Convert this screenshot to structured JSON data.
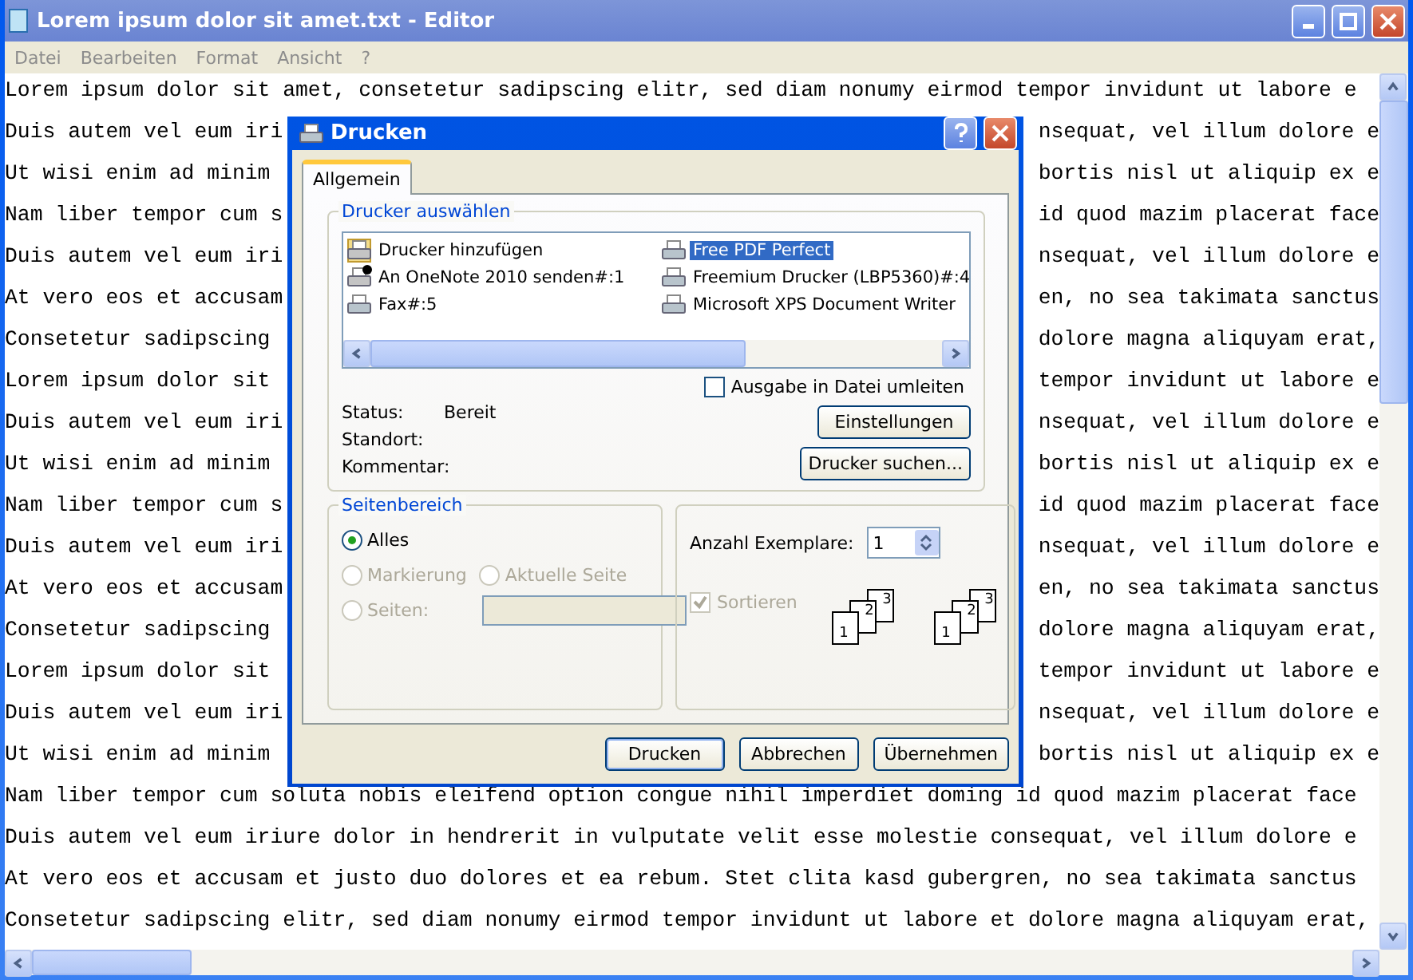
{
  "window": {
    "title": "Lorem ipsum dolor sit amet.txt - Editor"
  },
  "menu": [
    "Datei",
    "Bearbeiten",
    "Format",
    "Ansicht",
    "?"
  ],
  "editor": {
    "lines": [
      {
        "left": "Lorem ipsum dolor sit amet, consetetur sadipscing elitr, sed diam nonumy eirmod tempor invidunt ut labore e"
      },
      {
        "left": "Duis autem vel eum iri",
        "right": "nsequat, vel illum dolore e"
      },
      {
        "left": "Ut wisi enim ad minim",
        "right": "bortis nisl ut aliquip ex e"
      },
      {
        "left": "Nam liber tempor cum s",
        "right": "id quod mazim placerat face"
      },
      {
        "left": "Duis autem vel eum iri",
        "right": "nsequat, vel illum dolore e"
      },
      {
        "left": "At vero eos et accusam",
        "right": "en, no sea takimata sanctus"
      },
      {
        "left": "Consetetur sadipscing",
        "right": "dolore magna aliquyam erat,"
      },
      {
        "left": "Lorem ipsum dolor sit",
        "right": "tempor invidunt ut labore e"
      },
      {
        "left": "Duis autem vel eum iri",
        "right": "nsequat, vel illum dolore e"
      },
      {
        "left": "Ut wisi enim ad minim",
        "right": "bortis nisl ut aliquip ex e"
      },
      {
        "left": "Nam liber tempor cum s",
        "right": "id quod mazim placerat face"
      },
      {
        "left": "Duis autem vel eum iri",
        "right": "nsequat, vel illum dolore e"
      },
      {
        "left": "At vero eos et accusam",
        "right": "en, no sea takimata sanctus"
      },
      {
        "left": "Consetetur sadipscing",
        "right": "dolore magna aliquyam erat,"
      },
      {
        "left": "Lorem ipsum dolor sit",
        "right": "tempor invidunt ut labore e"
      },
      {
        "left": "Duis autem vel eum iri",
        "right": "nsequat, vel illum dolore e"
      },
      {
        "left": "Ut wisi enim ad minim",
        "right": "bortis nisl ut aliquip ex e"
      },
      {
        "left": "Nam liber tempor cum soluta nobis eleifend option congue nihil imperdiet doming id quod mazim placerat face"
      },
      {
        "left": "Duis autem vel eum iriure dolor in hendrerit in vulputate velit esse molestie consequat, vel illum dolore e"
      },
      {
        "left": "At vero eos et accusam et justo duo dolores et ea rebum. Stet clita kasd gubergren, no sea takimata sanctus"
      },
      {
        "left": "Consetetur sadipscing elitr, sed diam nonumy eirmod tempor invidunt ut labore et dolore magna aliquyam erat,"
      }
    ]
  },
  "dialog": {
    "title": "Drucken",
    "tabs": [
      {
        "label": "Allgemein",
        "selected": true
      }
    ],
    "printer_group": {
      "title": "Drucker auswählen",
      "printers": [
        {
          "name": "Drucker hinzufügen",
          "kind": "add",
          "selected": false
        },
        {
          "name": "An OneNote 2010 senden#:1",
          "kind": "default",
          "selected": false
        },
        {
          "name": "Fax#:5",
          "kind": "printer",
          "selected": false
        },
        {
          "name": "Free PDF Perfect",
          "kind": "printer",
          "selected": true
        },
        {
          "name": "Freemium Drucker (LBP5360)#:4",
          "kind": "printer",
          "selected": false
        },
        {
          "name": "Microsoft XPS Document Writer",
          "kind": "printer",
          "selected": false
        }
      ],
      "print_to_file": {
        "label": "Ausgabe in Datei umleiten",
        "checked": false
      },
      "info": [
        {
          "label": "Status:",
          "value": "Bereit"
        },
        {
          "label": "Standort:"
        },
        {
          "label": "Kommentar:"
        }
      ],
      "buttons": [
        "Einstellungen",
        "Drucker suchen..."
      ]
    },
    "page_range": {
      "title": "Seitenbereich",
      "options": [
        {
          "label": "Alles",
          "selected": true,
          "disabled": false
        },
        {
          "label": "Markierung",
          "selected": false,
          "disabled": true
        },
        {
          "label": "Aktuelle Seite",
          "selected": false,
          "disabled": true
        },
        {
          "label": "Seiten:",
          "selected": false,
          "disabled": true
        }
      ]
    },
    "copies": {
      "label": "Anzahl Exemplare:",
      "value": "1",
      "collate": {
        "label": "Sortieren",
        "checked": true,
        "disabled": true
      },
      "sets": [
        [
          "1",
          "2",
          "3"
        ],
        [
          "1",
          "2",
          "3"
        ]
      ]
    },
    "buttons": [
      {
        "label": "Drucken",
        "default": true
      },
      {
        "label": "Abbrechen",
        "default": false
      },
      {
        "label": "Übernehmen",
        "default": false
      }
    ]
  }
}
